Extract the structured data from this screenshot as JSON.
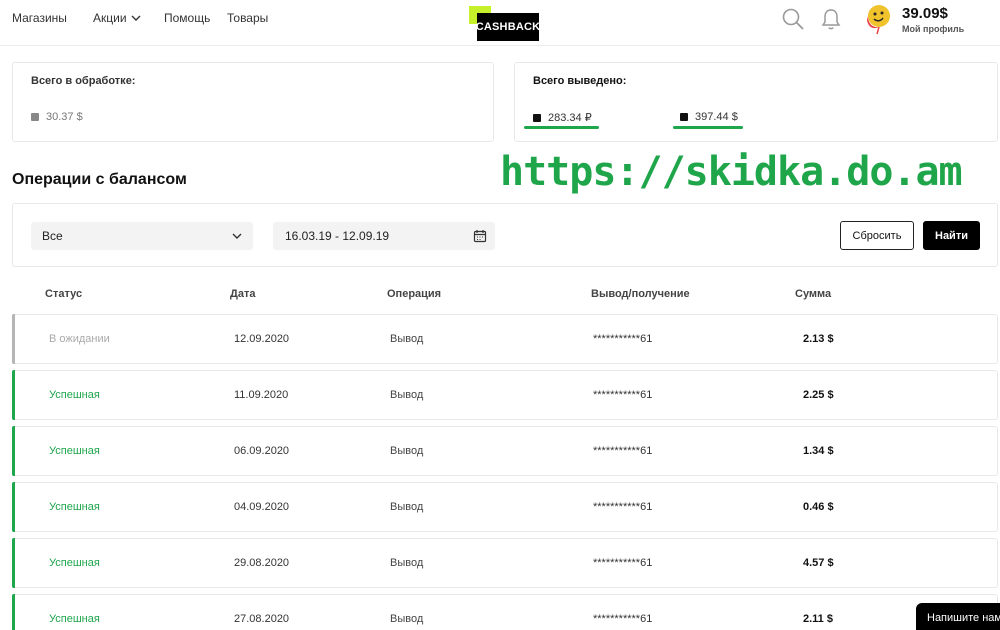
{
  "header": {
    "nav": [
      "Магазины",
      "Акции",
      "Помощь",
      "Товары"
    ],
    "logo_text": "CASHBACK",
    "balance": "39.09$",
    "profile_label": "Мой профиль",
    "icons": [
      "search-icon",
      "bell-icon",
      "avatar"
    ]
  },
  "summary": {
    "processing": {
      "title": "Всего в обработке:",
      "amount": "30.37 $"
    },
    "withdrawn": {
      "title": "Всего выведено:",
      "amounts": [
        "283.34 ₽",
        "397.44 $"
      ]
    }
  },
  "watermark": "https://skidka.do.am",
  "operations": {
    "title": "Операции с балансом",
    "filter": {
      "type_value": "Все",
      "date_range": "16.03.19 - 12.09.19",
      "reset_label": "Сбросить",
      "find_label": "Найти"
    },
    "columns": [
      "Статус",
      "Дата",
      "Операция",
      "Вывод/получение",
      "Сумма"
    ],
    "rows": [
      {
        "status": "В ожидании",
        "date": "12.09.2020",
        "operation": "Вывод",
        "account": "***********61",
        "amount": "2.13 $"
      },
      {
        "status": "Успешная",
        "date": "11.09.2020",
        "operation": "Вывод",
        "account": "***********61",
        "amount": "2.25 $"
      },
      {
        "status": "Успешная",
        "date": "06.09.2020",
        "operation": "Вывод",
        "account": "***********61",
        "amount": "1.34 $"
      },
      {
        "status": "Успешная",
        "date": "04.09.2020",
        "operation": "Вывод",
        "account": "***********61",
        "amount": "0.46 $"
      },
      {
        "status": "Успешная",
        "date": "29.08.2020",
        "operation": "Вывод",
        "account": "***********61",
        "amount": "4.57 $"
      },
      {
        "status": "Успешная",
        "date": "27.08.2020",
        "operation": "Вывод",
        "account": "***********61",
        "amount": "2.11 $"
      }
    ]
  },
  "chat_widget": "Напишите нам",
  "colors": {
    "accent_green": "#1fa64b",
    "logo_lime": "#c6f02a",
    "pending_grey": "#b5b5b5"
  }
}
